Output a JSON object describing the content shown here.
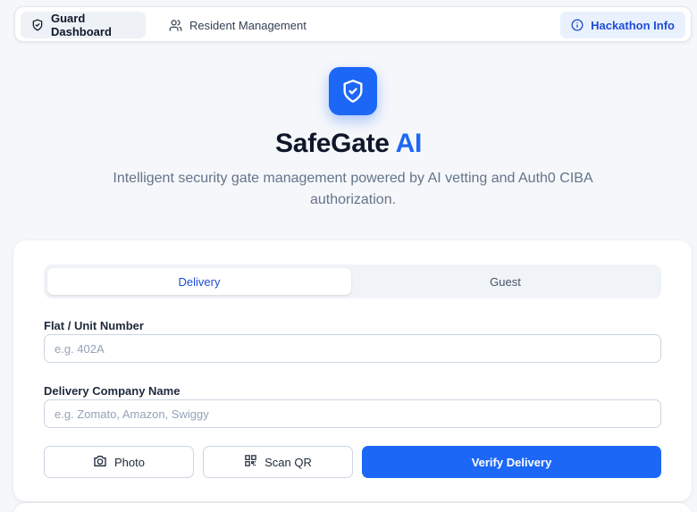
{
  "nav": {
    "guard_label": "Guard Dashboard",
    "resident_label": "Resident Management",
    "info_label": "Hackathon Info",
    "icons": {
      "guard": "shield-icon",
      "resident": "users-icon",
      "info": "info-circle-icon"
    }
  },
  "hero": {
    "icon": "shield-check-icon",
    "brand_main": "SafeGate",
    "brand_accent": "AI",
    "tagline": "Intelligent security gate management powered by AI vetting and Auth0 CIBA authorization."
  },
  "form": {
    "tabs": [
      {
        "label": "Delivery",
        "active": true
      },
      {
        "label": "Guest",
        "active": false
      }
    ],
    "flat_label": "Flat / Unit Number",
    "flat_placeholder": "e.g. 402A",
    "flat_value": "",
    "company_label": "Delivery Company Name",
    "company_placeholder": "e.g. Zomato, Amazon, Swiggy",
    "company_value": "",
    "photo_button": "Photo",
    "scan_button": "Scan QR",
    "verify_button": "Verify Delivery",
    "icons": {
      "photo": "camera-icon",
      "scan": "qr-code-icon"
    }
  },
  "colors": {
    "accent": "#1d67f6",
    "background": "#f5f7fa",
    "muted_text": "#64748b"
  }
}
